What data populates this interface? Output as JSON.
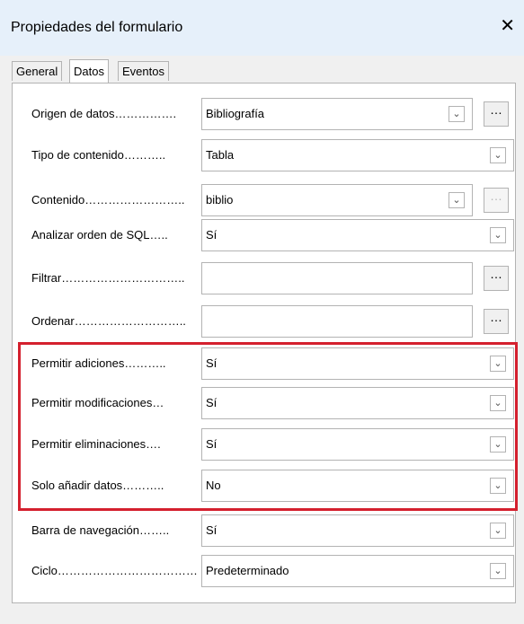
{
  "window": {
    "title": "Propiedades del formulario",
    "close_icon": "close-icon"
  },
  "tabs": [
    "General",
    "Datos",
    "Eventos"
  ],
  "rows": [
    {
      "label": "Origen de datos…………….",
      "value": "Bibliografía",
      "type": "combo",
      "has_more": true,
      "more_disabled": false
    },
    {
      "label": "Tipo de contenido………..",
      "value": "Tabla",
      "type": "select"
    },
    {
      "label": "Contenido……………………..",
      "value": "biblio",
      "type": "combo",
      "has_more": true,
      "more_disabled": true
    },
    {
      "label": "Analizar orden de SQL…..",
      "value": "Sí",
      "type": "select"
    },
    {
      "label": "Filtrar…………………………..",
      "value": "",
      "type": "text",
      "has_more": true,
      "more_disabled": false
    },
    {
      "label": "Ordenar………………………..",
      "value": "",
      "type": "text",
      "has_more": true,
      "more_disabled": false
    },
    {
      "label": "Permitir adiciones………..",
      "value": "Sí",
      "type": "select"
    },
    {
      "label": "Permitir modificaciones…",
      "value": "Sí",
      "type": "select"
    },
    {
      "label": "Permitir eliminaciones….",
      "value": "Sí",
      "type": "select"
    },
    {
      "label": "Solo añadir datos………..",
      "value": "No",
      "type": "select"
    },
    {
      "label": "Barra de navegación……..",
      "value": "Sí",
      "type": "select"
    },
    {
      "label": "Ciclo………………………………",
      "value": "Predeterminado",
      "type": "select"
    }
  ],
  "more_button_label": "…"
}
